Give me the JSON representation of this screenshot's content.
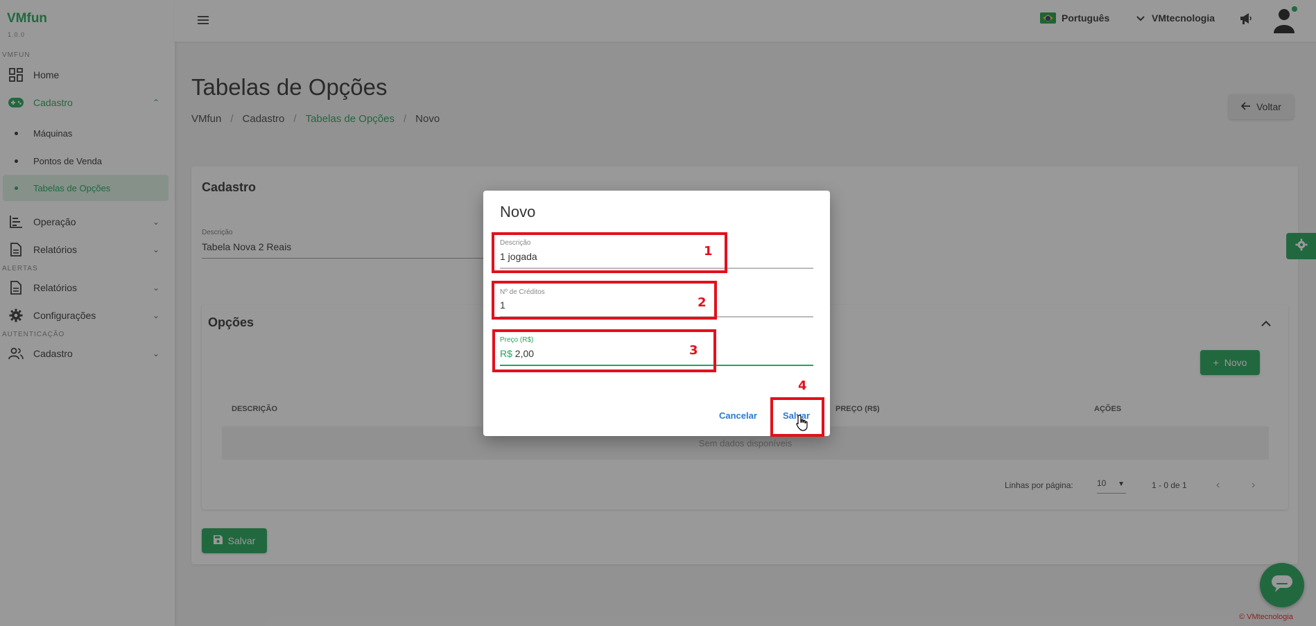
{
  "sidebar": {
    "brand": "VMfun",
    "version": "1.0.0",
    "section_vmfun": "VMFUN",
    "home": "Home",
    "cadastro": "Cadastro",
    "sub_items": [
      "Máquinas",
      "Pontos de Venda",
      "Tabelas de Opções"
    ],
    "operacao": "Operação",
    "relatorios": "Relatórios",
    "section_alertas": "ALERTAS",
    "alert_relatorios": "Relatórios",
    "configuracoes": "Configurações",
    "section_auth": "AUTENTICAÇÃO",
    "auth_cadastro": "Cadastro"
  },
  "topbar": {
    "language": "Português",
    "user": "VMtecnologia"
  },
  "page": {
    "title": "Tabelas de Opções",
    "breadcrumb": [
      "VMfun",
      "Cadastro",
      "Tabelas de Opções",
      "Novo"
    ],
    "back_label": "Voltar"
  },
  "form": {
    "title": "Cadastro",
    "descricao_label": "Descrição",
    "descricao_value": "Tabela Nova 2 Reais"
  },
  "options": {
    "title": "Opções",
    "novo_label": "Novo",
    "columns": [
      "DESCRIÇÃO",
      "PREÇO (R$)",
      "AÇÕES"
    ],
    "empty_text": "Sem dados disponíveis",
    "rows_per_page_label": "Linhas por página:",
    "rows_per_page_value": "10",
    "range_text": "1 - 0 de 1",
    "save_label": "Salvar"
  },
  "modal": {
    "title": "Novo",
    "descricao_label": "Descrição",
    "descricao_value": "1 jogada",
    "creditos_label": "Nº de Créditos",
    "creditos_value": "1",
    "preco_label": "Preço (R$)",
    "preco_prefix": "R$",
    "preco_value": "2,00",
    "cancel_label": "Cancelar",
    "save_label": "Salvar"
  },
  "annotations": [
    "1",
    "2",
    "3",
    "4"
  ],
  "footer": {
    "copyright": "© VMtecnologia"
  },
  "colors": {
    "accent": "#23a55a",
    "annotation": "#e3101c",
    "link": "#2a79d1"
  }
}
